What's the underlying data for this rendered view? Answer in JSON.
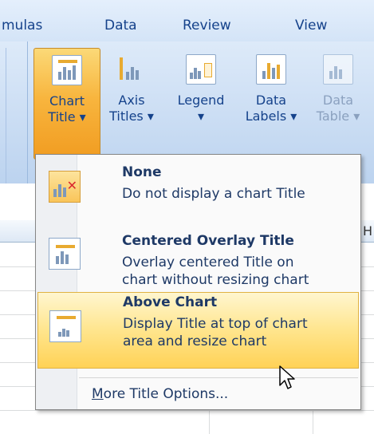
{
  "tabs": [
    {
      "label": "mulas"
    },
    {
      "label": "Data"
    },
    {
      "label": "Review"
    },
    {
      "label": "View"
    }
  ],
  "ribbon": {
    "chart_title": {
      "line1": "Chart",
      "line2": "Title ▾"
    },
    "axis_titles": {
      "line1": "Axis",
      "line2": "Titles ▾"
    },
    "legend": {
      "line1": "Legend",
      "line2": "▾"
    },
    "data_labels": {
      "line1": "Data",
      "line2": "Labels ▾"
    },
    "data_table": {
      "line1": "Data",
      "line2": "Table ▾"
    }
  },
  "menu": {
    "items": [
      {
        "heading": "None",
        "desc1": "Do not display a chart Title",
        "desc2": ""
      },
      {
        "heading": "Centered Overlay Title",
        "desc1": "Overlay centered Title on",
        "desc2": "chart without resizing chart"
      },
      {
        "heading": "Above Chart",
        "desc1": "Display Title at top of chart",
        "desc2": "area and resize chart"
      }
    ],
    "more_options": {
      "underlined": "M",
      "rest": "ore Title Options..."
    }
  },
  "sheet": {
    "col_header_partial": "H"
  },
  "colors": {
    "ribbon_text": "#15428b",
    "active_orange": "#f8b53e",
    "hover_yellow": "#ffe58d",
    "menu_text": "#1e3966"
  },
  "icons": [
    "chart-title-icon",
    "axis-titles-icon",
    "legend-icon",
    "data-labels-icon",
    "data-table-icon",
    "no-title-icon",
    "centered-overlay-title-icon",
    "above-chart-title-icon",
    "mouse-pointer-icon"
  ]
}
